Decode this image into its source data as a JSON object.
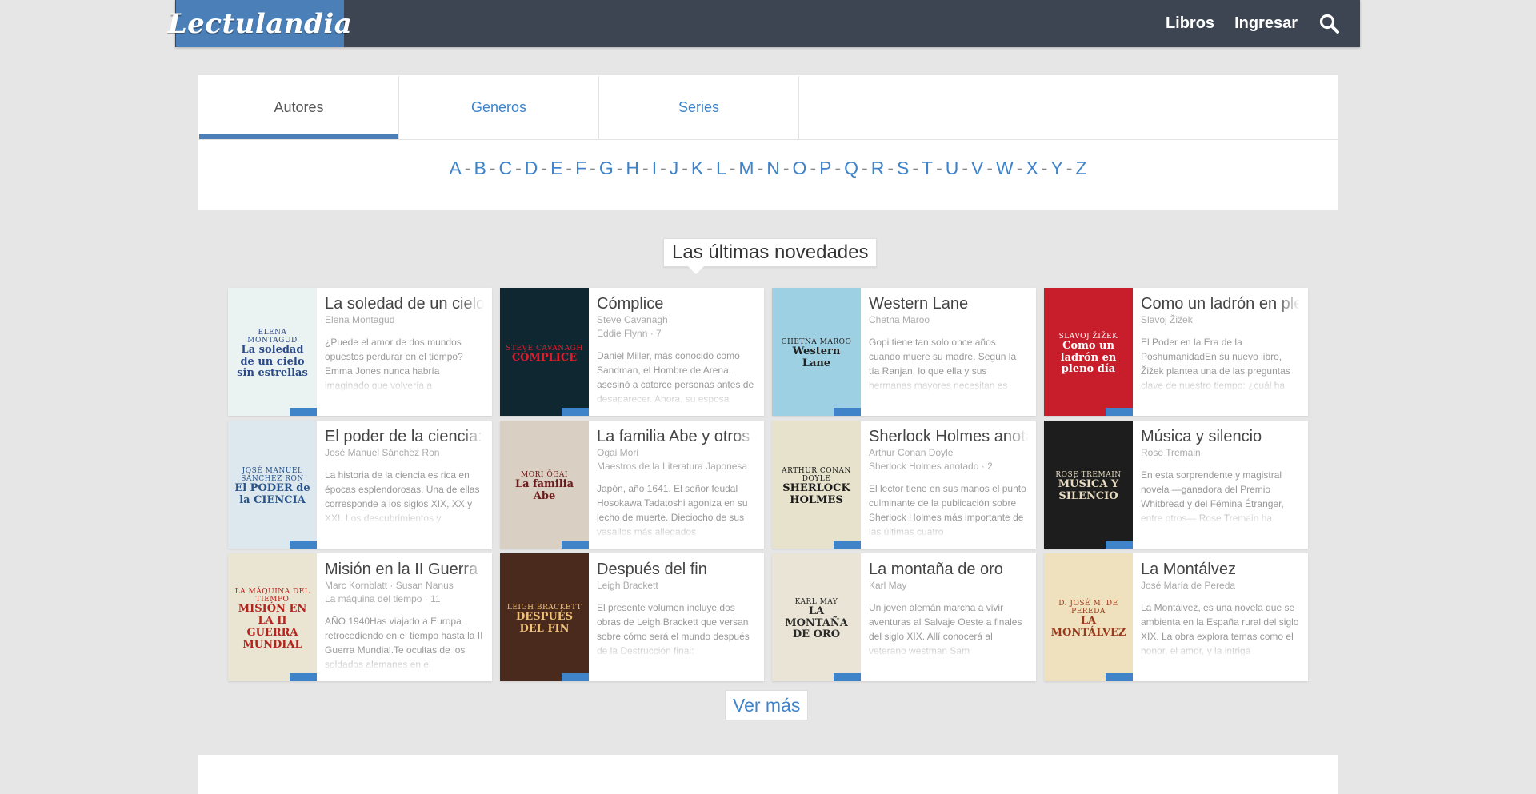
{
  "header": {
    "logo": "Lectulandia",
    "nav": [
      "Libros",
      "Ingresar"
    ],
    "search_icon": "search-icon"
  },
  "tabs": [
    {
      "label": "Autores",
      "active": true
    },
    {
      "label": "Generos",
      "active": false
    },
    {
      "label": "Series",
      "active": false
    }
  ],
  "alphabet": [
    "A",
    "B",
    "C",
    "D",
    "E",
    "F",
    "G",
    "H",
    "I",
    "J",
    "K",
    "L",
    "M",
    "N",
    "O",
    "P",
    "Q",
    "R",
    "S",
    "T",
    "U",
    "V",
    "W",
    "X",
    "Y",
    "Z"
  ],
  "section_title": "Las últimas novedades",
  "books": [
    {
      "title": "La soledad de un cielo sin estrellas",
      "author": "Elena Montagud",
      "series": "",
      "desc": "¿Puede el amor de dos mundos opuestos perdurar en el tiempo? Emma Jones nunca habría imaginado que volvería a",
      "cover": {
        "text": "La soledad de un cielo sin estrellas",
        "author": "ELENA MONTAGUD",
        "bg": "#eaf2f2",
        "fg": "#2b4a8a"
      }
    },
    {
      "title": "Cómplice",
      "author": "Steve Cavanagh",
      "series": "Eddie Flynn · 7",
      "desc": "Daniel Miller, más conocido como Sandman, el Hombre de Arena, asesinó a catorce personas antes de desaparecer. Ahora, su esposa",
      "cover": {
        "text": "CÓMPLICE",
        "author": "Steve Cavanagh",
        "bg": "#0f2730",
        "fg": "#e21b2a"
      }
    },
    {
      "title": "Western Lane",
      "author": "Chetna Maroo",
      "series": "",
      "desc": "Gopi tiene tan solo once años cuando muere su madre. Según la tía Ranjan, lo que ella y sus hermanas mayores necesitan es",
      "cover": {
        "text": "Western Lane",
        "author": "CHETNA MAROO",
        "bg": "#9ed0e4",
        "fg": "#222222"
      }
    },
    {
      "title": "Como un ladrón en pleno día",
      "author": "Slavoj Žižek",
      "series": "",
      "desc": "El Poder en la Era de la PoshumanidadEn su nuevo libro, Žižek plantea una de las preguntas clave de nuestro tiempo: ¿cuál ha",
      "cover": {
        "text": "Como un ladrón en pleno día",
        "author": "SLAVOJ ŽIŽEK",
        "bg": "#c81e2c",
        "fg": "#ffffff"
      }
    },
    {
      "title": "El poder de la ciencia: Historia social, política y económica",
      "author": "José Manuel Sánchez Ron",
      "series": "",
      "desc": "La historia de la ciencia es rica en épocas esplendorosas. Una de ellas corresponde a los siglos XIX, XX y XXI. Los descubrimientos y",
      "cover": {
        "text": "El PODER de la CIENCIA",
        "author": "JOSÉ MANUEL SÁNCHEZ RON",
        "bg": "#dde8ee",
        "fg": "#27538a"
      }
    },
    {
      "title": "La familia Abe y otros relatos",
      "author": "Ogai Mori",
      "series": "Maestros de la Literatura Japonesa",
      "desc": "Japón, año 1641. El señor feudal Hosokawa Tadatoshi agoniza en su lecho de muerte. Dieciocho de sus vasallos más allegados",
      "cover": {
        "text": "La familia Abe",
        "author": "Mori Ōgai",
        "bg": "#d9cfc2",
        "fg": "#6a1a1a"
      }
    },
    {
      "title": "Sherlock Holmes anotado",
      "author": "Arthur Conan Doyle",
      "series": "Sherlock Holmes anotado · 2",
      "desc": "El lector tiene en sus manos el punto culminante de la publicación sobre Sherlock Holmes más importante de las últimas cuatro",
      "cover": {
        "text": "SHERLOCK HOLMES",
        "author": "Arthur Conan Doyle",
        "bg": "#e7e2cc",
        "fg": "#1a1a1a"
      }
    },
    {
      "title": "Música y silencio",
      "author": "Rose Tremain",
      "series": "",
      "desc": "En esta sorprendente y magistral novela —ganadora del Premio Whitbread y del Fémina Étranger, entre otros— Rose Tremain ha",
      "cover": {
        "text": "MÚSICA Y SILENCIO",
        "author": "ROSE TREMAIN",
        "bg": "#1d1d1d",
        "fg": "#e8dcc0"
      }
    },
    {
      "title": "Misión en la II Guerra Mundial",
      "author": "Marc Kornblatt · Susan Nanus",
      "series": "La máquina del tiempo · 11",
      "desc": "AÑO 1940Has viajado a Europa retrocediendo en el tiempo hasta la II Guerra Mundial.Te ocultas de los soldados alemanes en el",
      "cover": {
        "text": "MISIÓN EN LA II GUERRA MUNDIAL",
        "author": "LA MÁQUINA DEL TIEMPO",
        "bg": "#eae4d2",
        "fg": "#b3241c"
      }
    },
    {
      "title": "Después del fin",
      "author": "Leigh Brackett",
      "series": "",
      "desc": "El presente volumen incluye dos obras de Leigh Brackett que versan sobre cómo será el mundo después de la Destrucción final:",
      "cover": {
        "text": "DESPUÉS DEL FIN",
        "author": "LEIGH BRACKETT",
        "bg": "#4a2a1c",
        "fg": "#f0c27a"
      }
    },
    {
      "title": "La montaña de oro",
      "author": "Karl May",
      "series": "",
      "desc": "Un joven alemán marcha a vivir aventuras al Salvaje Oeste a finales del siglo XIX. Allí conocerá al veterano westman Sam",
      "cover": {
        "text": "LA MONTAÑA DE ORO",
        "author": "Karl May",
        "bg": "#e9e4d6",
        "fg": "#2a2a2a"
      }
    },
    {
      "title": "La Montálvez",
      "author": "José María de Pereda",
      "series": "",
      "desc": "La Montálvez, es una novela que se ambienta en la España rural del siglo XIX. La obra explora temas como el honor, el amor, y la intriga",
      "cover": {
        "text": "LA MONTÁLVEZ",
        "author": "D. JOSÉ M. DE PEREDA",
        "bg": "#efe1be",
        "fg": "#9a3a1c"
      }
    }
  ],
  "more_button": "Ver más"
}
